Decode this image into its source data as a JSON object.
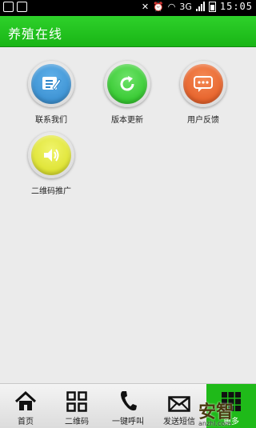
{
  "status": {
    "network": "3G",
    "time": "15:05"
  },
  "header": {
    "title": "养殖在线"
  },
  "grid": [
    {
      "label": "联系我们",
      "color": "#2f86c9",
      "icon": "document-edit-icon"
    },
    {
      "label": "版本更新",
      "color": "#1fbf1a",
      "icon": "refresh-icon"
    },
    {
      "label": "用户反馈",
      "color": "#e0521a",
      "icon": "chat-bubble-icon"
    },
    {
      "label": "二维码推广",
      "color": "#d7dc1d",
      "icon": "speaker-icon"
    }
  ],
  "nav": [
    {
      "label": "首页",
      "icon": "home-icon"
    },
    {
      "label": "二维码",
      "icon": "qrcode-icon"
    },
    {
      "label": "一键呼叫",
      "icon": "phone-icon"
    },
    {
      "label": "发送短信",
      "icon": "envelope-icon"
    },
    {
      "label": "更多",
      "icon": "grid-icon",
      "active": true
    }
  ],
  "watermark": {
    "text": "安智",
    "sub": "anzhi.com"
  }
}
